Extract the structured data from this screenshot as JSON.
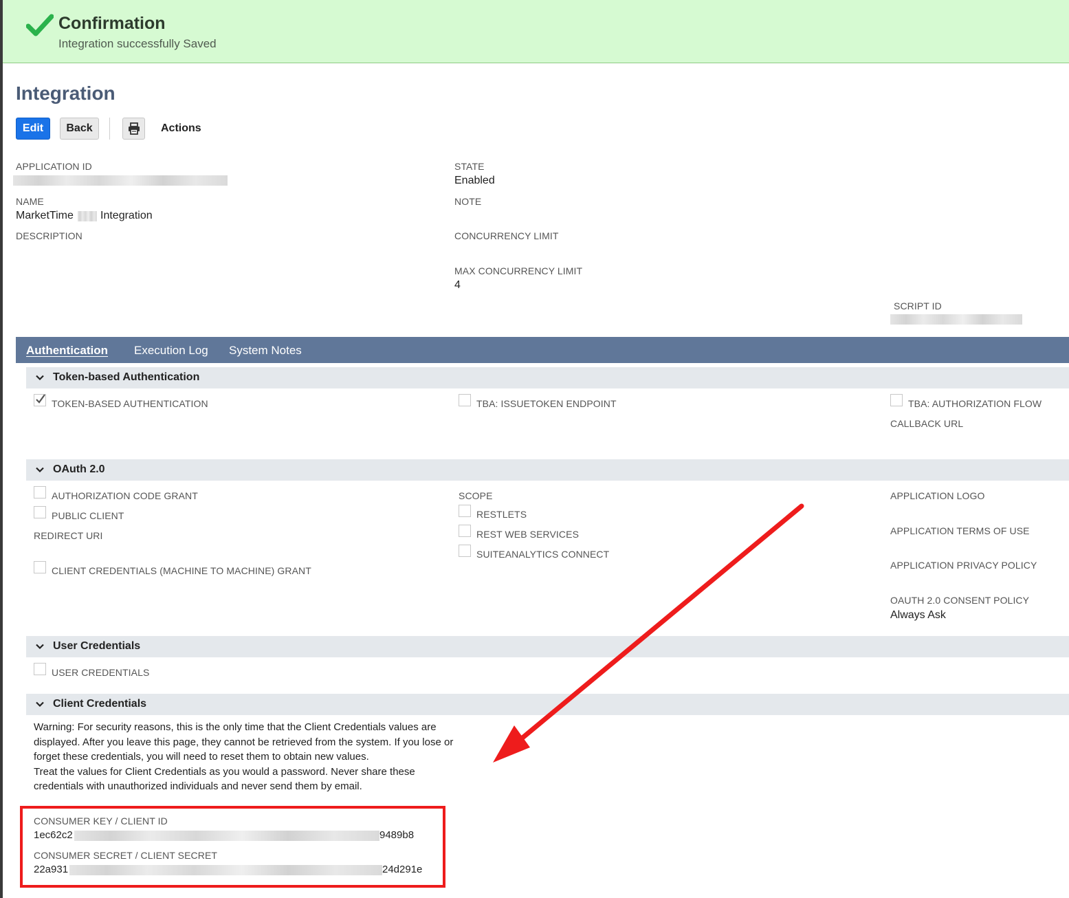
{
  "confirmation": {
    "title": "Confirmation",
    "message": "Integration successfully Saved"
  },
  "page": {
    "title": "Integration"
  },
  "toolbar": {
    "edit_label": "Edit",
    "back_label": "Back",
    "actions_label": "Actions"
  },
  "fields": {
    "application_id_label": "APPLICATION ID",
    "name_label": "NAME",
    "name_value_prefix": "MarketTime",
    "name_value_suffix": "Integration",
    "description_label": "DESCRIPTION",
    "state_label": "STATE",
    "state_value": "Enabled",
    "note_label": "NOTE",
    "concurrency_limit_label": "CONCURRENCY LIMIT",
    "max_concurrency_limit_label": "MAX CONCURRENCY LIMIT",
    "max_concurrency_limit_value": "4",
    "script_id_label": "SCRIPT ID"
  },
  "tabs": [
    {
      "label": "Authentication",
      "active": true
    },
    {
      "label": "Execution Log",
      "active": false
    },
    {
      "label": "System Notes",
      "active": false
    }
  ],
  "sections": {
    "tba": {
      "title": "Token-based Authentication",
      "token_based_auth": {
        "label": "TOKEN-BASED AUTHENTICATION",
        "checked": true
      },
      "issuetoken_endpoint": {
        "label": "TBA: ISSUETOKEN ENDPOINT",
        "checked": false
      },
      "authorization_flow": {
        "label": "TBA: AUTHORIZATION FLOW",
        "checked": false
      },
      "callback_url_label": "CALLBACK URL"
    },
    "oauth": {
      "title": "OAuth 2.0",
      "authorization_code_grant": {
        "label": "AUTHORIZATION CODE GRANT",
        "checked": false
      },
      "public_client": {
        "label": "PUBLIC CLIENT",
        "checked": false
      },
      "redirect_uri_label": "REDIRECT URI",
      "client_credentials_grant": {
        "label": "CLIENT CREDENTIALS (MACHINE TO MACHINE) GRANT",
        "checked": false
      },
      "scope_label": "SCOPE",
      "restlets": {
        "label": "RESTLETS",
        "checked": false
      },
      "rest_web_services": {
        "label": "REST WEB SERVICES",
        "checked": false
      },
      "suiteanalytics_connect": {
        "label": "SUITEANALYTICS CONNECT",
        "checked": false
      },
      "application_logo_label": "APPLICATION LOGO",
      "application_terms_label": "APPLICATION TERMS OF USE",
      "application_privacy_label": "APPLICATION PRIVACY POLICY",
      "consent_policy_label": "OAUTH 2.0 CONSENT POLICY",
      "consent_policy_value": "Always Ask"
    },
    "user_credentials": {
      "title": "User Credentials",
      "user_credentials": {
        "label": "USER CREDENTIALS",
        "checked": false
      }
    },
    "client_credentials": {
      "title": "Client Credentials",
      "warning_1": "Warning: For security reasons, this is the only time that the Client Credentials values are displayed. After you leave this page, they cannot be retrieved from the system. If you lose or forget these credentials, you will need to reset them to obtain new values.",
      "warning_2": "Treat the values for Client Credentials as you would a password. Never share these credentials with unauthorized individuals and never send them by email.",
      "consumer_key_label": "CONSUMER KEY / CLIENT ID",
      "consumer_key_prefix": "1ec62c2",
      "consumer_key_suffix": "9489b8",
      "consumer_secret_label": "CONSUMER SECRET / CLIENT SECRET",
      "consumer_secret_prefix": "22a931",
      "consumer_secret_suffix": "24d291e"
    }
  },
  "colors": {
    "confirmation_bg": "#d6fad2",
    "accent_blue": "#1a73e8",
    "tabbar": "#607799",
    "section_bg": "#e4e8ec",
    "highlight_red": "#ee1c1c",
    "title": "#4a5b76"
  },
  "icons": {
    "confirmation": "checkmark-icon",
    "print": "printer-icon",
    "section_toggle": "chevron-down-icon"
  }
}
